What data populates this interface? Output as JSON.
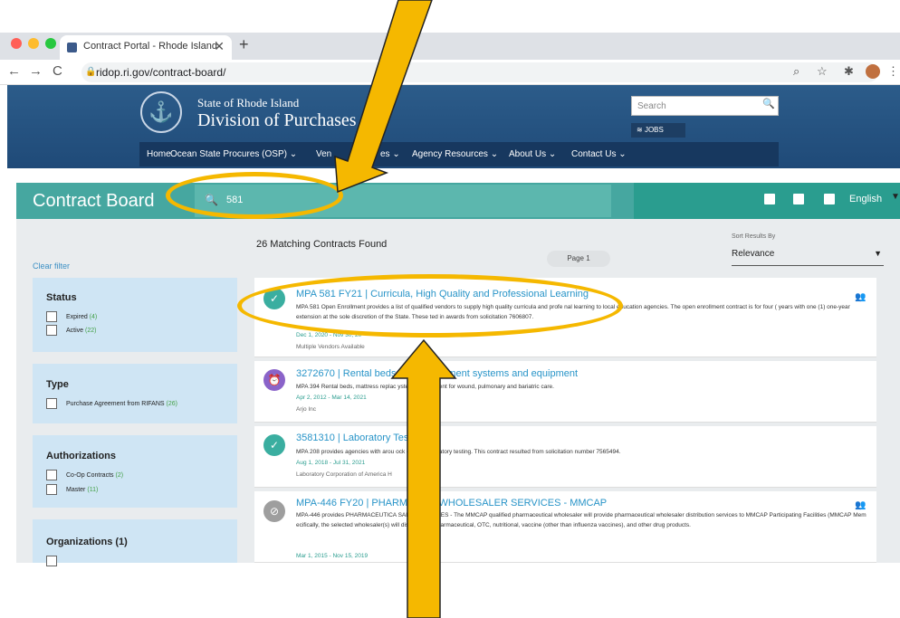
{
  "browser": {
    "tab_title": "Contract Portal - Rhode Island",
    "tab_close": "✕",
    "new_tab": "+",
    "url": "ridop.ri.gov/contract-board/",
    "back": "←",
    "forward": "→",
    "reload": "C",
    "lock": "🔒",
    "zoom_icon": "⌕",
    "star_icon": "☆",
    "extensions_icon": "✱",
    "menu_icon": "⋮"
  },
  "site": {
    "state_name": "State of Rhode Island",
    "division_name": "Division of Purchases",
    "seal_glyph": "⚓",
    "search_placeholder": "Search",
    "search_icon": "🔍",
    "jobs_label": "JOBS",
    "nav": [
      {
        "label": "Home"
      },
      {
        "label": "Ocean State Procures (OSP) ⌄"
      },
      {
        "label": "Ven"
      },
      {
        "label": "es ⌄"
      },
      {
        "label": "Agency Resources ⌄"
      },
      {
        "label": "About Us ⌄"
      },
      {
        "label": "Contact Us ⌄"
      }
    ]
  },
  "board": {
    "title": "Contract Board",
    "search_value": "581",
    "search_icon": "🔍",
    "language": "English",
    "language_caret": "▼",
    "clear_filter": "Clear filter",
    "match_count": "26 Matching Contracts Found",
    "page_label": "Page 1",
    "sort_label": "Sort Results By",
    "sort_value": "Relevance",
    "sort_caret": "▼"
  },
  "filters": [
    {
      "title": "Status",
      "options": [
        {
          "label": "Expired",
          "count": "(4)"
        },
        {
          "label": "Active",
          "count": "(22)"
        }
      ]
    },
    {
      "title": "Type",
      "options": [
        {
          "label": "Purchase Agreement from RIFANS",
          "count": "(26)"
        }
      ]
    },
    {
      "title": "Authorizations",
      "options": [
        {
          "label": "Co-Op Contracts",
          "count": "(2)"
        },
        {
          "label": "Master",
          "count": "(11)"
        }
      ]
    },
    {
      "title": "Organizations (1)",
      "options": []
    }
  ],
  "results": [
    {
      "icon": "✓",
      "color": "#3aaea0",
      "title": "MPA 581 FY21 | Curricula, High Quality and Professional Learning",
      "desc": "MPA 581 Open Enrollment provides a list of qualified vendors to supply high quality curricula and profe          nal learning to local education agencies. The open enrollment contract is for four (      years with one (1) one-year extension at the sole discretion of the State. These        ted in awards from solicitation 7606807.",
      "date": "Dec 1, 2020 - Nov 30, 20",
      "vendor": "Multiple Vendors Available",
      "people": "👥"
    },
    {
      "icon": "⏰",
      "color": "#8a63c9",
      "title": "3272670 | Rental beds, matt         placement systems and equipment",
      "desc": "MPA 394 Rental beds, mattress replac          ystems, equipment for wound, pulmonary and bariatric care.",
      "date": "Apr 2, 2012 - Mar 14, 2021",
      "vendor": "Arjo Inc",
      "people": ""
    },
    {
      "icon": "✓",
      "color": "#3aaea0",
      "title": "3581310 | Laboratory Testin         ces",
      "desc": "MPA 208 provides agencies with arou          ock clinical laboratory testing. This contract resulted from solicitation number 7565494.",
      "date": "Aug 1, 2018 - Jul 31, 2021",
      "vendor": "Laboratory Corporation of America H",
      "people": ""
    },
    {
      "icon": "⊘",
      "color": "#9e9e9e",
      "title": "MPA-446 FY20 | PHARMACE         L WHOLESALER SERVICES - MMCAP",
      "desc": "MPA-446 provides PHARMACEUTICA         SALER SERVICES - The MMCAP qualified pharmaceutical wholesaler will provide pharmaceutical wholesaler distribution services to MMCAP Participating Facilities (MMCAP Mem          ecifically, the selected wholesaler(s) will distribute all pharmaceutical, OTC, nutritional, vaccine (other than influenza vaccines), and other drug products.",
      "date": "Mar 1, 2015 - Nov 15, 2019",
      "vendor": "",
      "people": "👥"
    }
  ],
  "colors": {
    "accent_teal": "#46a7a0",
    "header_blue": "#2c5c8a",
    "annotation_yellow": "#f5b800"
  }
}
